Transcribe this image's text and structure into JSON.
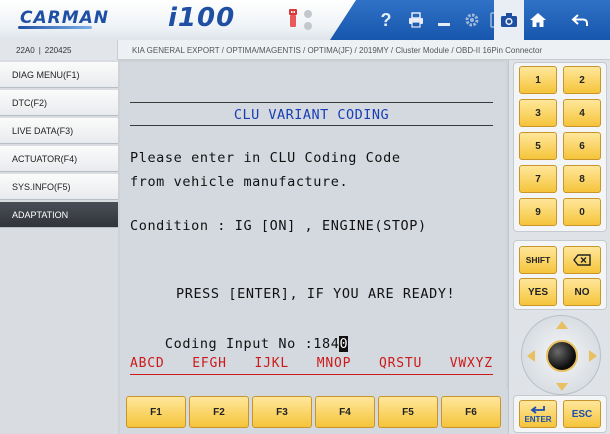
{
  "header": {
    "brand": "CARMAN",
    "device": "i100",
    "icons": [
      "usb-icon",
      "help-icon",
      "print-icon",
      "minimize-icon",
      "settings-icon",
      "save-icon",
      "camera-icon",
      "home-icon",
      "back-icon"
    ],
    "help_label": "?"
  },
  "vehicle": {
    "code1": "22A0",
    "separator": "|",
    "code2": "220425",
    "path": "KIA GENERAL EXPORT / OPTIMA/MAGENTIS / OPTIMA(JF) / 2019MY / Cluster Module / OBD-II 16Pin Connector"
  },
  "menu": {
    "items": [
      {
        "label": "DIAG MENU(F1)",
        "active": false
      },
      {
        "label": "DTC(F2)",
        "active": false
      },
      {
        "label": "LIVE DATA(F3)",
        "active": false
      },
      {
        "label": "ACTUATOR(F4)",
        "active": false
      },
      {
        "label": "SYS.INFO(F5)",
        "active": false
      },
      {
        "label": "ADAPTATION",
        "active": true
      }
    ]
  },
  "screen": {
    "title": "CLU VARIANT CODING",
    "line1": "Please enter in CLU Coding Code",
    "line2": "from vehicle manufacture.",
    "condition": "Condition : IG [ON] , ENGINE(STOP)",
    "prompt": "PRESS [ENTER], IF YOU ARE READY!",
    "input_label": "Coding Input No :",
    "input_value": "184",
    "cursor_char": "0",
    "letter_keys": [
      "ABCD",
      "EFGH",
      "IJKL",
      "MNOP",
      "QRSTU",
      "VWXYZ"
    ]
  },
  "fkeys": [
    "F1",
    "F2",
    "F3",
    "F4",
    "F5",
    "F6"
  ],
  "keypad": {
    "digits": [
      "1",
      "2",
      "3",
      "4",
      "5",
      "6",
      "7",
      "8",
      "9",
      "0"
    ],
    "shift": "SHIFT",
    "yes": "YES",
    "no": "NO",
    "enter": "ENTER",
    "esc": "ESC"
  },
  "colors": {
    "accent_blue": "#1f4fa3",
    "key_yellow": "#f5c43a",
    "title_text": "#1a3fb5",
    "letter_keys_red": "#cc1a1a",
    "active_menu": "#31343a"
  }
}
